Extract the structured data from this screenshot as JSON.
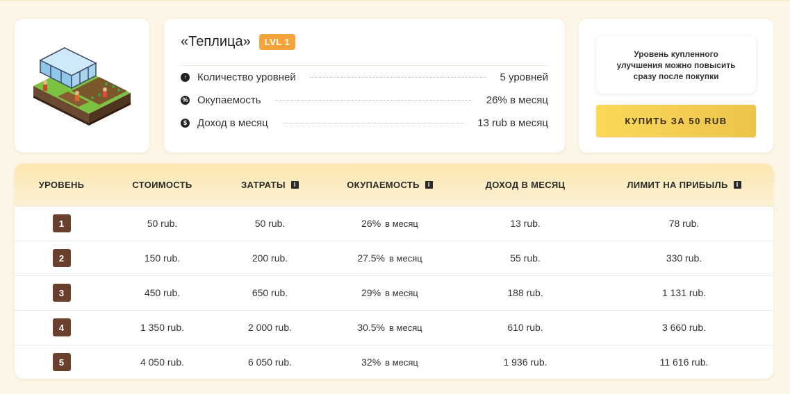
{
  "product": {
    "title": "«Теплица»",
    "level_badge": "LVL 1",
    "stats": [
      {
        "icon": "arrow-up-icon",
        "label": "Количество уровней",
        "value": "5 уровней"
      },
      {
        "icon": "percent-icon",
        "label": "Окупаемость",
        "value": "26% в месяц"
      },
      {
        "icon": "dollar-icon",
        "label": "Доход в месяц",
        "value": "13 rub в месяц"
      }
    ]
  },
  "buy": {
    "notice": "Уровень купленного улучшения можно повысить сразу после покупки",
    "button_label": "КУПИТЬ ЗА 50 RUB"
  },
  "table": {
    "headers": [
      "УРОВЕНЬ",
      "СТОИМОСТЬ",
      "ЗАТРАТЫ",
      "ОКУПАЕМОСТЬ",
      "ДОХОД В МЕСЯЦ",
      "ЛИМИТ НА ПРИБЫЛЬ"
    ],
    "per_month_label": "в месяц",
    "rows": [
      {
        "level": "1",
        "cost": "50 rub.",
        "expenses": "50 rub.",
        "payback": "26%",
        "income": "13 rub.",
        "limit": "78 rub."
      },
      {
        "level": "2",
        "cost": "150 rub.",
        "expenses": "200 rub.",
        "payback": "27.5%",
        "income": "55 rub.",
        "limit": "330 rub."
      },
      {
        "level": "3",
        "cost": "450 rub.",
        "expenses": "650 rub.",
        "payback": "29%",
        "income": "188 rub.",
        "limit": "1 131 rub."
      },
      {
        "level": "4",
        "cost": "1 350 rub.",
        "expenses": "2 000 rub.",
        "payback": "30.5%",
        "income": "610 rub.",
        "limit": "3 660 rub."
      },
      {
        "level": "5",
        "cost": "4 050 rub.",
        "expenses": "6 050 rub.",
        "payback": "32%",
        "income": "1 936 rub.",
        "limit": "11 616 rub."
      }
    ]
  }
}
